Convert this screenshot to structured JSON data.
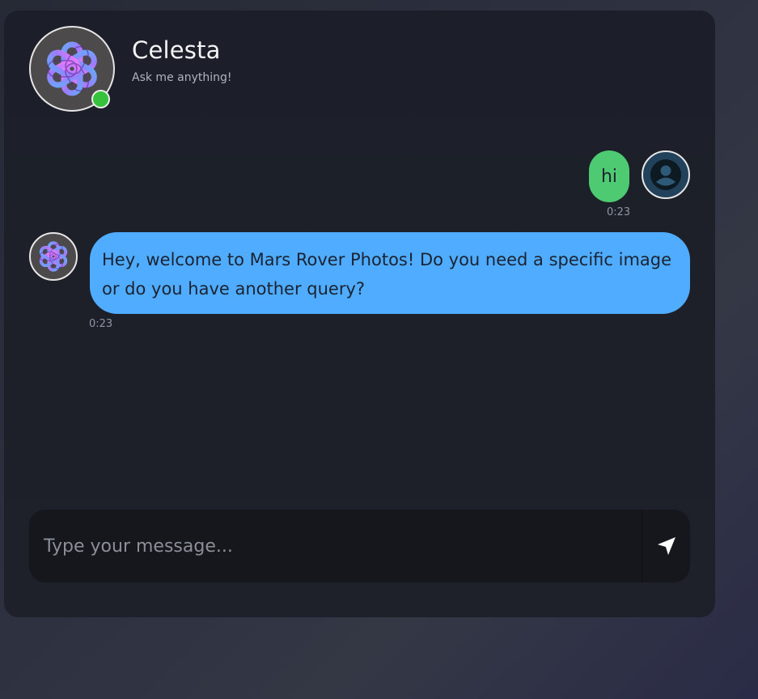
{
  "header": {
    "bot_name": "Celesta",
    "tagline": "Ask me anything!",
    "status": "online",
    "avatar_icon": "openai-knot-icon"
  },
  "messages": [
    {
      "sender": "user",
      "text": "hi",
      "time": "0:23",
      "avatar_icon": "user-silhouette-icon"
    },
    {
      "sender": "bot",
      "text": "Hey, welcome to Mars Rover Photos! Do you need a specific image or do you have another query?",
      "time": "0:23",
      "avatar_icon": "openai-knot-icon"
    }
  ],
  "composer": {
    "placeholder": "Type your message...",
    "value": "",
    "send_icon": "paper-plane-icon"
  },
  "colors": {
    "user_bubble": "#4ecb72",
    "bot_bubble": "#4facfe",
    "online": "#36c23d",
    "card_bg": "#1d2029"
  }
}
